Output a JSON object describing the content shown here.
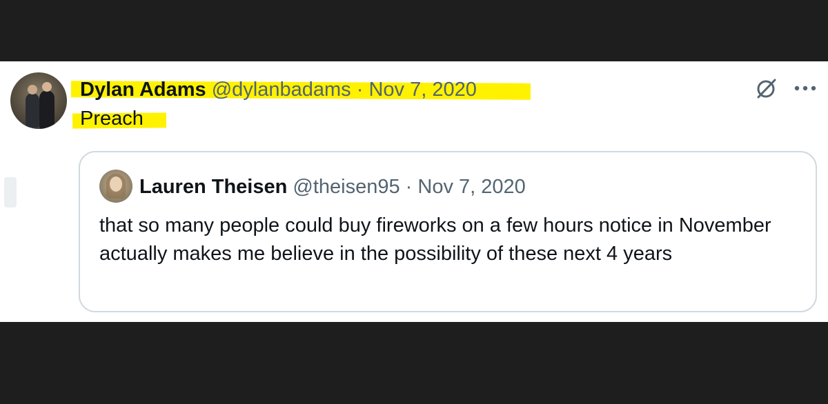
{
  "tweet": {
    "author_name": "Dylan Adams",
    "author_handle": "@dylanbadams",
    "separator": "·",
    "date": "Nov 7, 2020",
    "text": "Preach"
  },
  "quoted_tweet": {
    "author_name": "Lauren Theisen",
    "author_handle": "@theisen95",
    "separator": "·",
    "date": "Nov 7, 2020",
    "text": "that so many people could buy fireworks on a few hours notice in November actually makes me believe in the possibility of these next 4 years"
  },
  "icons": {
    "grok": "grok-icon",
    "more": "more-options-icon"
  },
  "colors": {
    "highlight": "#fff200",
    "secondary_text": "#536471",
    "primary_text": "#0f1419",
    "background_bars": "#1e1e1e"
  }
}
